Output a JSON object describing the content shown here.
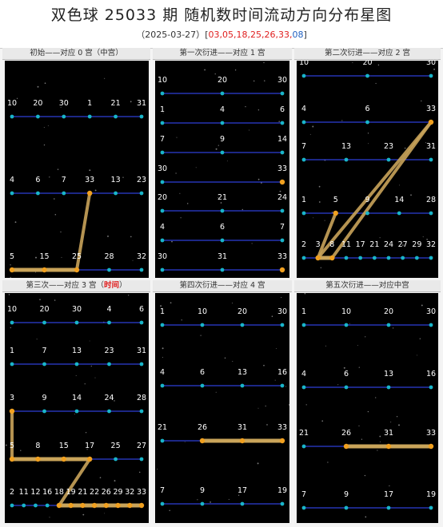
{
  "title": "双色球 25033 期  随机数时间流动方向分布星图",
  "subtitle": {
    "date": "（2025-03-27）",
    "open": "[",
    "reds": "03,05,18,25,26,33,",
    "blue": "08",
    "close": "]"
  },
  "colors": {
    "node": "#19b5c9",
    "line": "#2d3fd6",
    "highlight": "#c9a45a",
    "bg": "#000000"
  },
  "panels": [
    {
      "label": "初始——对应 0 宫（中宫）",
      "rows": [
        {
          "nums": [
            "10",
            "20",
            "30",
            "1",
            "21",
            "31"
          ],
          "hl": []
        },
        {
          "nums": [
            "4",
            "6",
            "7",
            "33",
            "13",
            "23"
          ],
          "hl": [
            3
          ]
        },
        {
          "nums": [
            "5",
            "15",
            "25",
            "28",
            "32"
          ],
          "hl": [
            0,
            1,
            2
          ]
        }
      ],
      "links": [
        [
          1,
          3,
          2,
          2
        ]
      ]
    },
    {
      "label": "第一次衍进——对应 1 宫",
      "rows": [
        {
          "nums": [
            "10",
            "20",
            "30"
          ],
          "hl": []
        },
        {
          "nums": [
            "1",
            "4",
            "6"
          ],
          "hl": []
        },
        {
          "nums": [
            "7",
            "9",
            "14"
          ],
          "hl": []
        },
        {
          "nums": [
            "30",
            "33"
          ],
          "hl": [
            1
          ]
        },
        {
          "nums": [
            "20",
            "21",
            "24"
          ],
          "hl": []
        },
        {
          "nums": [
            "4",
            "6",
            "7"
          ],
          "hl": []
        },
        {
          "nums": [
            "30",
            "31",
            "33"
          ],
          "hl": [
            2
          ]
        }
      ],
      "links": []
    },
    {
      "label": "第二次衍进——对应 2 宫",
      "rows": [
        {
          "nums": [
            "10",
            "20",
            "30"
          ],
          "hl": []
        },
        {
          "nums": [
            "4",
            "6",
            "33"
          ],
          "hl": [
            2
          ]
        },
        {
          "nums": [
            "7",
            "13",
            "23",
            "31"
          ],
          "hl": []
        },
        {
          "nums": [
            "1",
            "5",
            "9",
            "14",
            "28"
          ],
          "hl": [
            1
          ]
        },
        {
          "nums": [
            "2",
            "3",
            "8",
            "11",
            "17",
            "21",
            "24",
            "27",
            "29",
            "32"
          ],
          "hl": [
            1,
            2
          ]
        }
      ],
      "links": [
        [
          1,
          2,
          4,
          1
        ],
        [
          1,
          2,
          4,
          2
        ],
        [
          3,
          1,
          4,
          1
        ]
      ]
    },
    {
      "label": "第三次——对应 3 宫（",
      "labelRed": "时间",
      "labelEnd": "）",
      "rows": [
        {
          "nums": [
            "10",
            "20",
            "30",
            "4",
            "6"
          ],
          "hl": []
        },
        {
          "nums": [
            "1",
            "7",
            "13",
            "23",
            "31"
          ],
          "hl": []
        },
        {
          "nums": [
            "3",
            "9",
            "14",
            "24",
            "28"
          ],
          "hl": [
            0
          ]
        },
        {
          "nums": [
            "5",
            "8",
            "15",
            "17",
            "25",
            "27"
          ],
          "hl": [
            0,
            1,
            2,
            3
          ]
        },
        {
          "nums": [
            "2",
            "11",
            "12",
            "16",
            "18",
            "19",
            "21",
            "22",
            "26",
            "29",
            "32",
            "33"
          ],
          "hl": [
            4,
            5,
            6,
            7,
            8,
            9,
            10,
            11
          ]
        }
      ],
      "links": [
        [
          2,
          0,
          3,
          0
        ],
        [
          3,
          3,
          4,
          4
        ]
      ]
    },
    {
      "label": "第四次衍进——对应 4 宫",
      "rows": [
        {
          "nums": [
            "1",
            "10",
            "20",
            "30"
          ],
          "hl": []
        },
        {
          "nums": [
            "4",
            "6",
            "13",
            "16"
          ],
          "hl": []
        },
        {
          "nums": [
            "21",
            "26",
            "31",
            "33"
          ],
          "hl": [
            1,
            2,
            3
          ]
        },
        {
          "nums": [
            "7",
            "9",
            "17",
            "19"
          ],
          "hl": []
        }
      ],
      "links": []
    },
    {
      "label": "第五次衍进——对应中宫",
      "rows": [
        {
          "nums": [
            "1",
            "10",
            "20",
            "30"
          ],
          "hl": []
        },
        {
          "nums": [
            "4",
            "6",
            "13",
            "16"
          ],
          "hl": []
        },
        {
          "nums": [
            "21",
            "26",
            "31",
            "33"
          ],
          "hl": [
            1,
            2,
            3
          ]
        },
        {
          "nums": [
            "7",
            "9",
            "17",
            "19"
          ],
          "hl": []
        }
      ],
      "links": []
    }
  ]
}
